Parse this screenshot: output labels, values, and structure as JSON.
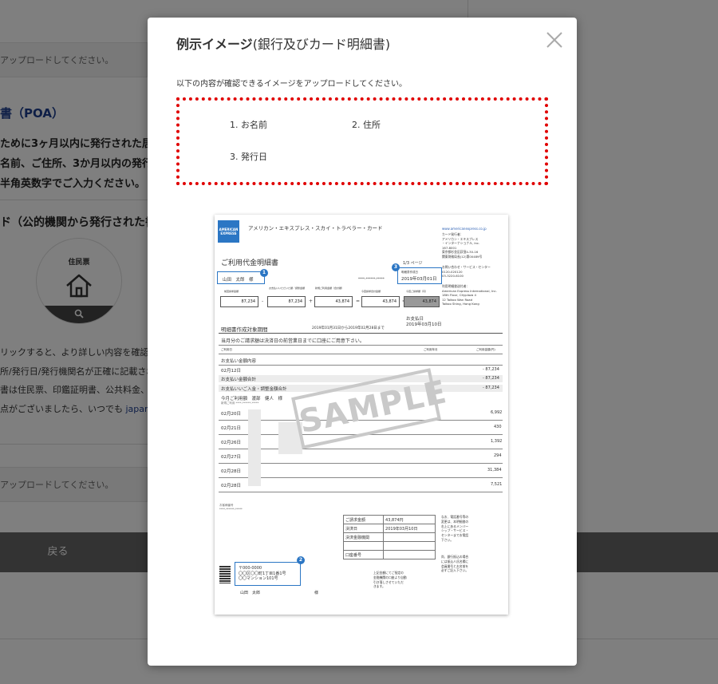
{
  "background": {
    "upload_hint_1": "アップロードしてください。",
    "poa_heading": "書（POA）",
    "poa_lines": [
      "ために3ヶ月以内に発行された居住",
      "名前、ご住所、3か月以内の発行",
      "半角英数字でご入力ください。"
    ],
    "card_heading": "ド（公的機関から発行された書",
    "card_circle_label": "住民票",
    "notes": [
      "リックすると、より詳しい内容を確認することがで",
      "所/発行日/発行機関名が正確に記載されて",
      "書は住民票、印鑑証明書、公共料金、電話",
      "点がございましたら、いつでも "
    ],
    "notes_link": "japan.support@la",
    "upload_hint_2": "アップロードしてください。",
    "back_button": "戻る"
  },
  "modal": {
    "title": "例示イメージ",
    "title_sub": "(銀行及びカード明細書)",
    "instruction": "以下の内容が確認できるイメージをアップロードしてください。",
    "items": [
      "1. お名前",
      "2. 住所",
      "3. 発行日"
    ],
    "close_icon": "close-icon"
  },
  "sample_doc": {
    "logo_lines": [
      "AMERICAN",
      "EXPRESS"
    ],
    "header_brand": "アメリカン・エキスプレス・スカイ・トラベラー・カード",
    "website": "www.americanexpress.co.jp",
    "issuer_block": [
      "カード発行者：",
      "アメリカン・エキスプレス",
      "・インターナショナル, Inc.",
      "167-8001",
      "東京都杉並区荻窪4-30-16",
      "関東財務局長(12)第00489号"
    ],
    "contact_block": [
      "お問い合わせ・サービス・センター",
      "0120-020120",
      "03-3220-6100"
    ],
    "processor_block": [
      "利用明細書送付者：",
      "American Express International, Inc.",
      "18th Floor, Cityplaza 4",
      "12 Taikoo Wan Road",
      "Taikoo Shing, Hong Kong"
    ],
    "title": "ご利用代金明細書",
    "page_label": "1/3  ページ",
    "customer_name": "山田　太郎　様",
    "member_no": "****-******-*****",
    "issue_date_label": "明細書作成日",
    "issue_date": "2019年03月01日",
    "amount_labels": [
      "前回請求金額",
      "お支払いいただいた額／調整金額",
      "新規ご利用金額（合計額）",
      "今回請求合計金額",
      "今回ご請求額（円）"
    ],
    "amounts": [
      "87,234",
      "87,234",
      "43,874",
      "43,874",
      "43,874"
    ],
    "operators": [
      "-",
      "+",
      "=",
      "="
    ],
    "payment_day_label": "お支払日",
    "payment_day": "2019年03月10日",
    "period_label": "明細書作成対象期間",
    "period": "2019年01月31日から2019年02月28日まで",
    "notice": "当月分のご請求額は決済日の前営業日までに口座にご用意下さい。",
    "col_date": "ご利用日",
    "col_month": "ご利用年月",
    "col_amount": "ご利用金額(円)",
    "section_payment": "お支払い金額内容",
    "row_payment_date": "02月12日",
    "row_payment_amount": "- 87,234",
    "total_label": "お支払い金額合計",
    "total_amount": "- 87,234",
    "adjusted_label": "お支払いいご入金・調整金額合計",
    "adjusted_amount": "- 87,234",
    "user_label": "今月ご利用額　渡部　健人　様",
    "user_sub": "新規ご利用 ****-******-*****",
    "transactions": [
      {
        "date": "02月20日",
        "amount": "6,992"
      },
      {
        "date": "02月21日",
        "amount": "430"
      },
      {
        "date": "02月26日",
        "amount": "1,392"
      },
      {
        "date": "02月27日",
        "amount": "294"
      },
      {
        "date": "02月28日",
        "amount": "31,384"
      },
      {
        "date": "02月28日",
        "amount": "7,521"
      }
    ],
    "watermark": "SAMPLE",
    "footer_left": [
      "お客様番号",
      "****-******-*****"
    ],
    "summary_rows": [
      {
        "label": "ご請求金額",
        "value": "43,874円"
      },
      {
        "label": "決済日",
        "value": "2019年03月10日"
      },
      {
        "label": "決済金融機関",
        "value": ""
      },
      {
        "label": "",
        "value": ""
      },
      {
        "label": "口座番号",
        "value": ""
      }
    ],
    "right_note_1": [
      "なお、電話番号等の",
      "変更は、本明細書の",
      "右上にあるメンバー",
      "シップ・サービス・",
      "センターまでお電話",
      "下さい。"
    ],
    "right_note_2": [
      "尚、銀行振込の場合",
      "には振込人氏名欄に",
      "会員番号とお名前を",
      "必ずご記入下さい。"
    ],
    "bottom_note": [
      "上記金額にてご指定の",
      "金融機関の口座より自動",
      "引き落しさせていただ",
      "きます。"
    ],
    "address_lines": [
      "〒000-0000",
      "〇〇区〇〇町1丁目1番1号",
      "〇〇マンション101号"
    ],
    "recipient": "山田　太郎",
    "recipient_suffix": "様",
    "markers": [
      "1",
      "2",
      "3"
    ]
  }
}
